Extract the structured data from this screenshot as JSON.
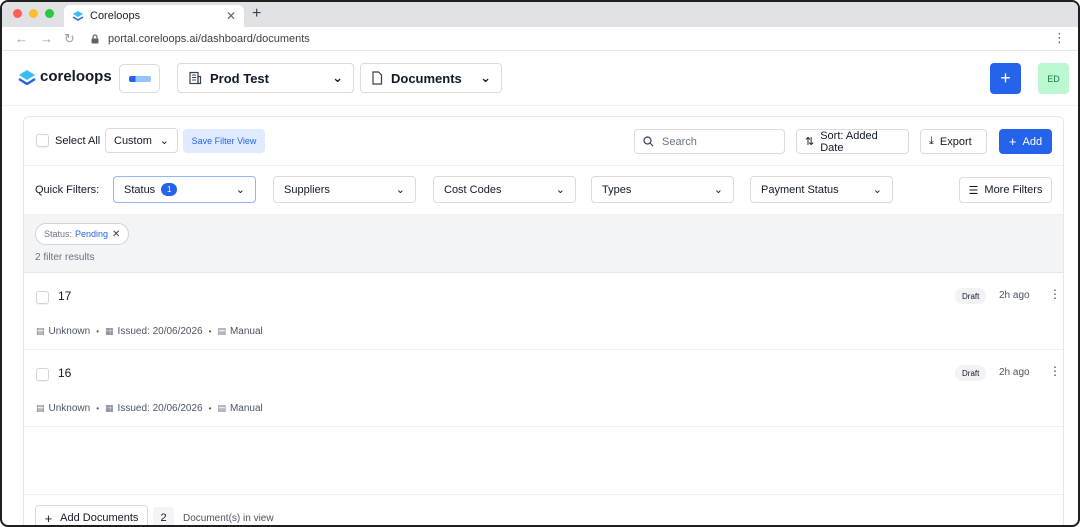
{
  "browser": {
    "tab_title": "Coreloops",
    "url": "portal.coreloops.ai/dashboard/documents"
  },
  "header": {
    "brand": "coreloops",
    "workspace": "Prod Test",
    "section": "Documents",
    "avatar_initials": "ED"
  },
  "toolbar": {
    "select_all": "Select All",
    "view": "Custom",
    "save_filter": "Save Filter View",
    "search_placeholder": "Search",
    "sort": "Sort: Added Date",
    "export": "Export",
    "add": "Add"
  },
  "filters": {
    "label": "Quick Filters:",
    "status": "Status",
    "status_count": "1",
    "suppliers": "Suppliers",
    "cost_codes": "Cost Codes",
    "types": "Types",
    "payment_status": "Payment Status",
    "more": "More Filters"
  },
  "active_filters": {
    "chip_key": "Status:",
    "chip_value": "Pending",
    "results": "2 filter results"
  },
  "documents": [
    {
      "number": "17",
      "supplier": "Unknown",
      "issued": "Issued: 20/06/2026",
      "source": "Manual",
      "status": "Draft",
      "age": "2h ago"
    },
    {
      "number": "16",
      "supplier": "Unknown",
      "issued": "Issued: 20/06/2026",
      "source": "Manual",
      "status": "Draft",
      "age": "2h ago"
    }
  ],
  "footer": {
    "add_documents": "Add Documents",
    "count": "2",
    "in_view": "Document(s) in view"
  },
  "colors": {
    "accent": "#2563eb",
    "avatar_bg": "#bbf7d0"
  }
}
